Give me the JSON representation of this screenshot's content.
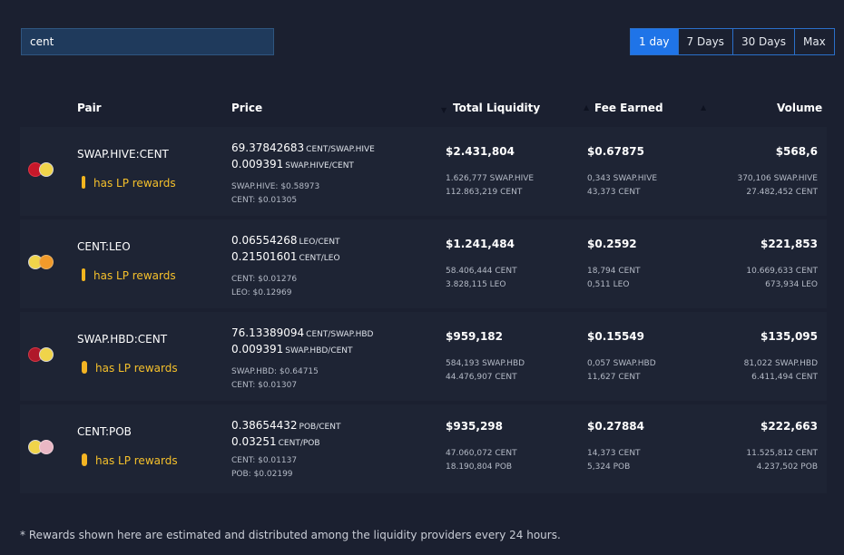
{
  "search": {
    "value": "cent"
  },
  "range_buttons": [
    "1 day",
    "7 Days",
    "30 Days",
    "Max"
  ],
  "range_selected": "1 day",
  "columns": {
    "pair": "Pair",
    "price": "Price",
    "total_liquidity": "Total Liquidity",
    "fee_earned": "Fee Earned",
    "volume": "Volume"
  },
  "lp_label": "has LP rewards",
  "rows": [
    {
      "pair": "SWAP.HIVE:CENT",
      "price_a": "69.37842683",
      "price_a_unit": "CENT/SWAP.HIVE",
      "price_b": "0.009391",
      "price_b_unit": "SWAP.HIVE/CENT",
      "usd_a": "SWAP.HIVE: $0.58973",
      "usd_b": "CENT: $0.01305",
      "liquidity": "$2.431,804",
      "liq_a": "1.626,777 SWAP.HIVE",
      "liq_b": "112.863,219 CENT",
      "fee": "$0.67875",
      "fee_a": "0,343 SWAP.HIVE",
      "fee_b": "43,373 CENT",
      "volume": "$568,6",
      "vol_a": "370,106 SWAP.HIVE",
      "vol_b": "27.482,452 CENT"
    },
    {
      "pair": "CENT:LEO",
      "price_a": "0.06554268",
      "price_a_unit": "LEO/CENT",
      "price_b": "0.21501601",
      "price_b_unit": "CENT/LEO",
      "usd_a": "CENT: $0.01276",
      "usd_b": "LEO: $0.12969",
      "liquidity": "$1.241,484",
      "liq_a": "58.406,444 CENT",
      "liq_b": "3.828,115 LEO",
      "fee": "$0.2592",
      "fee_a": "18,794 CENT",
      "fee_b": "0,511 LEO",
      "volume": "$221,853",
      "vol_a": "10.669,633 CENT",
      "vol_b": "673,934 LEO"
    },
    {
      "pair": "SWAP.HBD:CENT",
      "price_a": "76.13389094",
      "price_a_unit": "CENT/SWAP.HBD",
      "price_b": "0.009391",
      "price_b_unit": "SWAP.HBD/CENT",
      "usd_a": "SWAP.HBD: $0.64715",
      "usd_b": "CENT: $0.01307",
      "liquidity": "$959,182",
      "liq_a": "584,193 SWAP.HBD",
      "liq_b": "44.476,907 CENT",
      "fee": "$0.15549",
      "fee_a": "0,057 SWAP.HBD",
      "fee_b": "11,627 CENT",
      "volume": "$135,095",
      "vol_a": "81,022 SWAP.HBD",
      "vol_b": "6.411,494 CENT"
    },
    {
      "pair": "CENT:POB",
      "price_a": "0.38654432",
      "price_a_unit": "POB/CENT",
      "price_b": "0.03251",
      "price_b_unit": "CENT/POB",
      "usd_a": "CENT: $0.01137",
      "usd_b": "POB: $0.02199",
      "liquidity": "$935,298",
      "liq_a": "47.060,072 CENT",
      "liq_b": "18.190,804 POB",
      "fee": "$0.27884",
      "fee_a": "14,373 CENT",
      "fee_b": "5,324 POB",
      "volume": "$222,663",
      "vol_a": "11.525,812 CENT",
      "vol_b": "4.237,502 POB"
    }
  ],
  "footer": "* Rewards shown here are estimated and distributed among the liquidity providers every 24 hours.",
  "colors": {
    "accent": "#1f74e8",
    "lp": "#f5c02b",
    "bg": "#1b2030",
    "row": "#1e2434"
  }
}
